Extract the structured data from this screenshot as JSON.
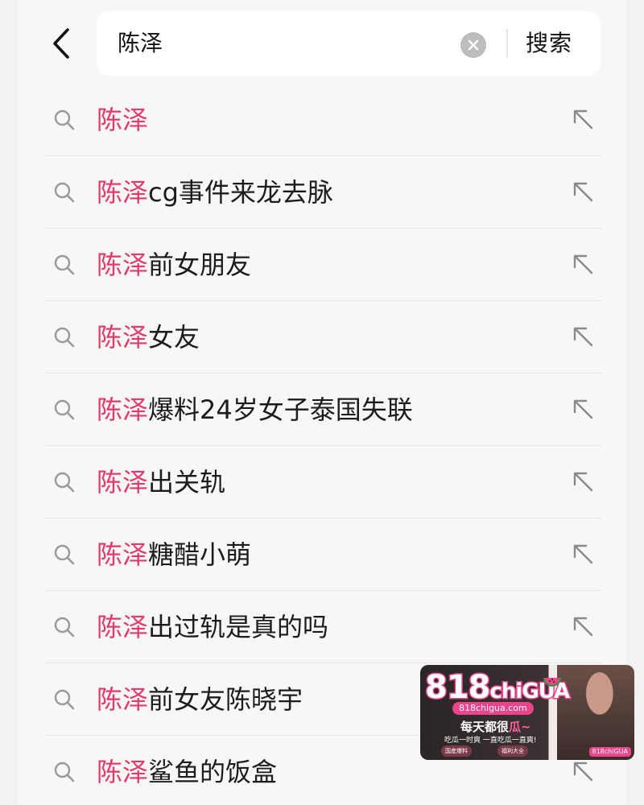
{
  "search": {
    "query": "陈泽",
    "submit_label": "搜索"
  },
  "suggestions": [
    {
      "highlight": "陈泽",
      "rest": ""
    },
    {
      "highlight": "陈泽",
      "rest": "cg事件来龙去脉"
    },
    {
      "highlight": "陈泽",
      "rest": "前女朋友"
    },
    {
      "highlight": "陈泽",
      "rest": "女友"
    },
    {
      "highlight": "陈泽",
      "rest": "爆料24岁女子泰国失联"
    },
    {
      "highlight": "陈泽",
      "rest": "出关轨"
    },
    {
      "highlight": "陈泽",
      "rest": "糖醋小萌"
    },
    {
      "highlight": "陈泽",
      "rest": "出过轨是真的吗"
    },
    {
      "highlight": "陈泽",
      "rest": "前女友陈晓宇"
    },
    {
      "highlight": "陈泽",
      "rest": "鲨鱼的饭盒"
    }
  ],
  "ad": {
    "brand_number": "818",
    "brand_word": "chiGUA",
    "domain": "818chigua.com",
    "slogan_main": "每天都很",
    "slogan_accent": "瓜~",
    "sub": "吃瓜一时爽 一直吃瓜一直爽!",
    "pill_left": "国産爆料",
    "pill_right": "福利大全",
    "corner": "818chiGUA"
  },
  "colors": {
    "highlight": "#e33a67",
    "background": "#f7f7f7",
    "search_box": "#ffffff"
  },
  "icons": {
    "back": "chevron-left-icon",
    "clear": "clear-circle-icon",
    "search": "search-icon",
    "fill": "arrow-up-left-icon"
  }
}
